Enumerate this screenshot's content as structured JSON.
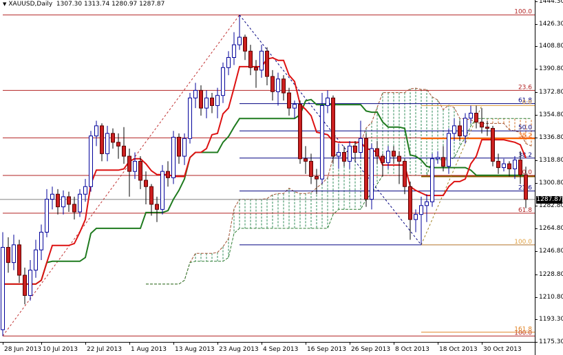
{
  "header": {
    "symbol": "XAUUSD,Daily",
    "ohlc": "1307.30 1313.74 1280.97 1287.87"
  },
  "current_price": "1287.87",
  "colors": {
    "bull_body": "#ffffff",
    "bull_border": "#00009a",
    "bear_body": "#cc2020",
    "bear_border": "#5a0000",
    "tenkan": "#dd1111",
    "kijun": "#1e7a1e",
    "cloud_bull": "#2e8b57",
    "cloud_bear": "#d2691e"
  },
  "chart_data": {
    "type": "candlestick",
    "title": "XAUUSD,Daily",
    "ylim": [
      1175.3,
      1444.3
    ],
    "yticks": [
      "1444.30",
      "1426.30",
      "1408.80",
      "1390.80",
      "1372.80",
      "1354.80",
      "1336.80",
      "1318.80",
      "1300.80",
      "1282.80",
      "1264.80",
      "1246.80",
      "1228.80",
      "1210.80",
      "1193.30",
      "1175.30"
    ],
    "xticks": [
      {
        "bar": 0,
        "label": "28 Jun 2013"
      },
      {
        "bar": 7,
        "label": "10 Jul 2013"
      },
      {
        "bar": 15,
        "label": "22 Jul 2013"
      },
      {
        "bar": 23,
        "label": "1 Aug 2013"
      },
      {
        "bar": 31,
        "label": "13 Aug 2013"
      },
      {
        "bar": 39,
        "label": "23 Aug 2013"
      },
      {
        "bar": 47,
        "label": "4 Sep 2013"
      },
      {
        "bar": 55,
        "label": "16 Sep 2013"
      },
      {
        "bar": 63,
        "label": "26 Sep 2013"
      },
      {
        "bar": 71,
        "label": "8 Oct 2013"
      },
      {
        "bar": 79,
        "label": "18 Oct 2013"
      },
      {
        "bar": 87,
        "label": "30 Oct 2013"
      }
    ],
    "ohlc": [
      [
        1185,
        1262,
        1180,
        1250
      ],
      [
        1250,
        1258,
        1230,
        1238
      ],
      [
        1238,
        1260,
        1232,
        1252
      ],
      [
        1252,
        1256,
        1222,
        1228
      ],
      [
        1228,
        1234,
        1205,
        1212
      ],
      [
        1212,
        1240,
        1208,
        1232
      ],
      [
        1232,
        1256,
        1226,
        1248
      ],
      [
        1248,
        1268,
        1240,
        1262
      ],
      [
        1262,
        1296,
        1258,
        1288
      ],
      [
        1288,
        1298,
        1280,
        1292
      ],
      [
        1292,
        1296,
        1276,
        1282
      ],
      [
        1282,
        1295,
        1276,
        1290
      ],
      [
        1290,
        1294,
        1278,
        1284
      ],
      [
        1284,
        1290,
        1272,
        1278
      ],
      [
        1278,
        1296,
        1274,
        1292
      ],
      [
        1292,
        1304,
        1286,
        1298
      ],
      [
        1298,
        1342,
        1294,
        1338
      ],
      [
        1338,
        1350,
        1330,
        1346
      ],
      [
        1346,
        1348,
        1318,
        1324
      ],
      [
        1324,
        1346,
        1318,
        1340
      ],
      [
        1340,
        1344,
        1328,
        1333
      ],
      [
        1333,
        1340,
        1320,
        1330
      ],
      [
        1330,
        1345,
        1316,
        1322
      ],
      [
        1322,
        1328,
        1290,
        1310
      ],
      [
        1310,
        1325,
        1304,
        1318
      ],
      [
        1318,
        1322,
        1296,
        1303
      ],
      [
        1303,
        1310,
        1284,
        1298
      ],
      [
        1298,
        1300,
        1275,
        1284
      ],
      [
        1284,
        1290,
        1270,
        1280
      ],
      [
        1280,
        1315,
        1276,
        1310
      ],
      [
        1310,
        1318,
        1298,
        1305
      ],
      [
        1305,
        1342,
        1300,
        1337
      ],
      [
        1337,
        1340,
        1316,
        1322
      ],
      [
        1322,
        1340,
        1315,
        1336
      ],
      [
        1336,
        1372,
        1332,
        1368
      ],
      [
        1368,
        1380,
        1360,
        1374
      ],
      [
        1374,
        1378,
        1354,
        1360
      ],
      [
        1360,
        1374,
        1352,
        1368
      ],
      [
        1368,
        1372,
        1356,
        1362
      ],
      [
        1362,
        1376,
        1352,
        1370
      ],
      [
        1370,
        1396,
        1364,
        1392
      ],
      [
        1392,
        1405,
        1386,
        1400
      ],
      [
        1400,
        1420,
        1394,
        1410
      ],
      [
        1410,
        1433.5,
        1406,
        1416
      ],
      [
        1416,
        1418,
        1398,
        1405
      ],
      [
        1405,
        1410,
        1386,
        1392
      ],
      [
        1392,
        1398,
        1376,
        1390
      ],
      [
        1390,
        1410,
        1384,
        1405
      ],
      [
        1405,
        1408,
        1378,
        1385
      ],
      [
        1385,
        1390,
        1366,
        1373
      ],
      [
        1373,
        1388,
        1362,
        1383
      ],
      [
        1383,
        1386,
        1366,
        1372
      ],
      [
        1372,
        1376,
        1354,
        1360
      ],
      [
        1360,
        1366,
        1352,
        1363
      ],
      [
        1363,
        1366,
        1316,
        1320
      ],
      [
        1320,
        1330,
        1308,
        1318
      ],
      [
        1318,
        1324,
        1300,
        1306
      ],
      [
        1306,
        1312,
        1292,
        1304
      ],
      [
        1304,
        1372,
        1300,
        1362
      ],
      [
        1362,
        1374,
        1356,
        1368
      ],
      [
        1368,
        1370,
        1316,
        1322
      ],
      [
        1322,
        1332,
        1312,
        1325
      ],
      [
        1325,
        1330,
        1314,
        1318
      ],
      [
        1318,
        1334,
        1312,
        1330
      ],
      [
        1330,
        1334,
        1318,
        1325
      ],
      [
        1325,
        1350,
        1320,
        1336
      ],
      [
        1336,
        1340,
        1282,
        1288
      ],
      [
        1288,
        1332,
        1280,
        1328
      ],
      [
        1328,
        1334,
        1316,
        1322
      ],
      [
        1322,
        1324,
        1306,
        1317
      ],
      [
        1317,
        1330,
        1312,
        1326
      ],
      [
        1326,
        1330,
        1316,
        1322
      ],
      [
        1322,
        1326,
        1300,
        1318
      ],
      [
        1318,
        1320,
        1292,
        1298
      ],
      [
        1298,
        1302,
        1256,
        1272
      ],
      [
        1272,
        1280,
        1262,
        1276
      ],
      [
        1276,
        1290,
        1252,
        1283
      ],
      [
        1283,
        1292,
        1270,
        1286
      ],
      [
        1286,
        1324,
        1282,
        1320
      ],
      [
        1320,
        1326,
        1316,
        1321
      ],
      [
        1321,
        1330,
        1310,
        1314
      ],
      [
        1314,
        1344,
        1308,
        1340
      ],
      [
        1340,
        1352,
        1334,
        1346
      ],
      [
        1346,
        1350,
        1334,
        1338
      ],
      [
        1338,
        1356,
        1332,
        1352
      ],
      [
        1352,
        1362,
        1348,
        1356
      ],
      [
        1356,
        1362,
        1344,
        1349
      ],
      [
        1349,
        1360,
        1340,
        1345
      ],
      [
        1345,
        1350,
        1338,
        1344
      ],
      [
        1344,
        1346,
        1314,
        1318
      ],
      [
        1318,
        1324,
        1308,
        1313
      ],
      [
        1313,
        1320,
        1310,
        1316
      ],
      [
        1316,
        1318,
        1306,
        1312
      ],
      [
        1312,
        1322,
        1304,
        1319
      ],
      [
        1319,
        1326,
        1300,
        1307.3
      ],
      [
        1307.3,
        1313.74,
        1280.97,
        1287.87
      ]
    ],
    "ichimoku": {
      "tenkan": 9,
      "kijun": 26,
      "senkou_b": 52,
      "shift": 26
    },
    "fib_levels": [
      {
        "set": "A",
        "price": 1433.6,
        "label": "100.0",
        "color": "#b22222",
        "from_bar": 0
      },
      {
        "set": "A",
        "price": 1374.0,
        "label": "23.6",
        "color": "#b22222",
        "from_bar": 0
      },
      {
        "set": "A",
        "price": 1336.5,
        "label": "",
        "color": "#b22222",
        "from_bar": 0
      },
      {
        "set": "A",
        "price": 1306.8,
        "label": "50.0",
        "color": "#b22222",
        "from_bar": 0
      },
      {
        "set": "A",
        "price": 1277.0,
        "label": "61.8",
        "color": "#b22222",
        "from_bar": 0
      },
      {
        "set": "A",
        "price": 1180.0,
        "label": "100.0",
        "color": "#b22222",
        "from_bar": 0
      },
      {
        "set": "B",
        "price": 1363.5,
        "label": "61.8",
        "color": "#000080",
        "from_bar": 43
      },
      {
        "set": "B",
        "price": 1342.0,
        "label": "50.0",
        "color": "#000080",
        "from_bar": 43
      },
      {
        "set": "B",
        "price": 1320.5,
        "label": "38.2",
        "color": "#000080",
        "from_bar": 43
      },
      {
        "set": "B",
        "price": 1294.5,
        "label": "23.6",
        "color": "#000080",
        "from_bar": 43
      },
      {
        "set": "B",
        "price": 1252.0,
        "label": "",
        "color": "#000080",
        "from_bar": 43
      },
      {
        "set": "C",
        "price": 1362.0,
        "label": "0.0",
        "color": "#e0a040",
        "from_bar": 76
      },
      {
        "set": "C",
        "price": 1336.0,
        "label": "38.2",
        "color": "#ff6a00",
        "from_bar": 76
      },
      {
        "set": "C",
        "price": 1306.0,
        "label": "",
        "color": "#8b5a00",
        "from_bar": 76
      },
      {
        "set": "C",
        "price": 1252.0,
        "label": "100.0",
        "color": "#e0a040",
        "from_bar": 76
      },
      {
        "set": "C",
        "price": 1183.0,
        "label": "161.8",
        "color": "#e08020",
        "from_bar": 76
      }
    ],
    "trendlines": [
      {
        "from": [
          0,
          1180
        ],
        "to": [
          43,
          1433.6
        ],
        "color": "#c03030"
      },
      {
        "from": [
          43,
          1433.6
        ],
        "to": [
          76,
          1252
        ],
        "color": "#000080"
      },
      {
        "from": [
          76,
          1252
        ],
        "to": [
          87,
          1362
        ],
        "color": "#a08020"
      }
    ]
  }
}
